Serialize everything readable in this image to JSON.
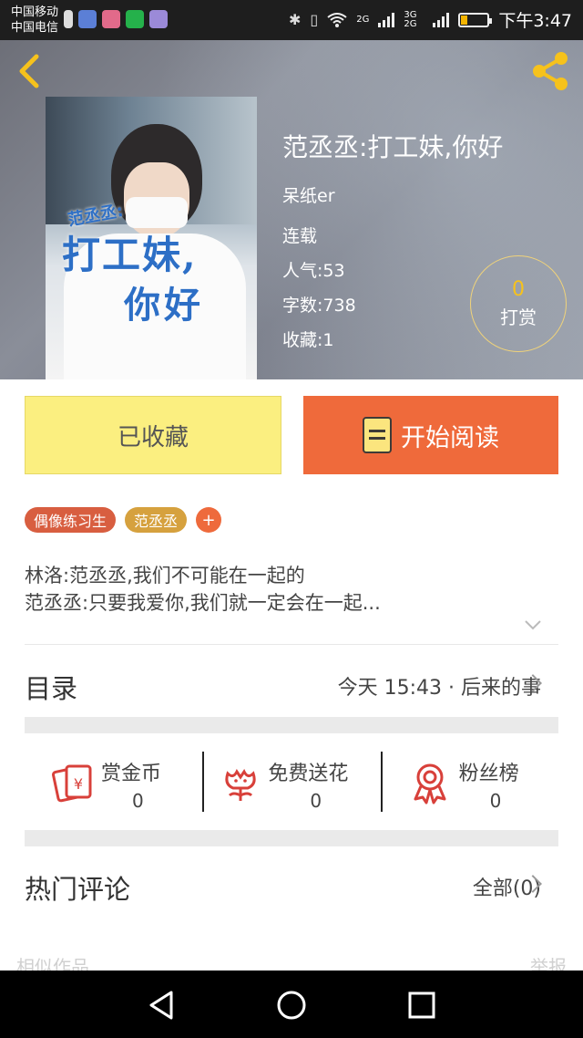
{
  "status_bar": {
    "carrier_1": "中国移动",
    "carrier_2": "中国电信",
    "network_1": "2G",
    "network_2": "3G 2G",
    "time": "下午3:47",
    "battery_level": 0.25
  },
  "header": {
    "back_icon": "chevron-left-icon",
    "share_icon": "share-icon"
  },
  "book": {
    "cover_text_small": "范丞丞:",
    "cover_text_line1": "打工妹,",
    "cover_text_line2": "你好",
    "title": "范丞丞:打工妹,你好",
    "author": "呆纸er",
    "status": "连载",
    "popularity": "人气:53",
    "word_count": "字数:738",
    "favorites": "收藏:1",
    "reward_count": "0",
    "reward_label": "打赏"
  },
  "actions": {
    "favorited_label": "已收藏",
    "start_reading_label": "开始阅读"
  },
  "tags": [
    "偶像练习生",
    "范丞丞",
    "+"
  ],
  "description": {
    "line1": "林洛:范丞丞,我们不可能在一起的",
    "line2": "范丞丞:只要我爱你,我们就一定会在一起..."
  },
  "toc": {
    "title": "目录",
    "latest": "今天 15:43 · 后来的事"
  },
  "stats": [
    {
      "label": "赏金币",
      "value": "0",
      "icon": "reward-coin-icon"
    },
    {
      "label": "免费送花",
      "value": "0",
      "icon": "flower-icon"
    },
    {
      "label": "粉丝榜",
      "value": "0",
      "icon": "medal-icon"
    }
  ],
  "comments": {
    "title": "热门评论",
    "all_label": "全部(0)"
  },
  "peek": {
    "left": "相似作品",
    "right": "举报"
  },
  "colors": {
    "accent_orange": "#ef6a3b",
    "accent_yellow": "#fbef80",
    "icon_red": "#d8403a",
    "gold": "#f6c21c"
  }
}
